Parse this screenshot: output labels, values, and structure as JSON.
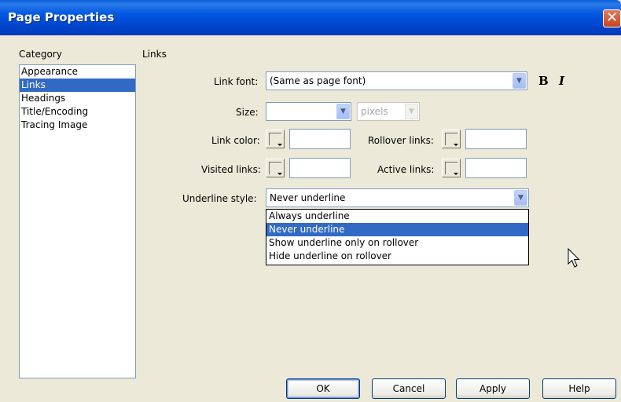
{
  "window": {
    "title": "Page Properties",
    "close_glyph": "✕"
  },
  "category": {
    "header": "Category",
    "items": [
      "Appearance",
      "Links",
      "Headings",
      "Title/Encoding",
      "Tracing Image"
    ],
    "selected_index": 1
  },
  "panel": {
    "heading": "Links",
    "link_font": {
      "label": "Link font:",
      "value": "(Same as page font)"
    },
    "bold_label": "B",
    "italic_label": "I",
    "size": {
      "label": "Size:",
      "value": "",
      "unit": "pixels"
    },
    "link_color": {
      "label": "Link color:",
      "value": ""
    },
    "rollover_links": {
      "label": "Rollover links:",
      "value": ""
    },
    "visited_links": {
      "label": "Visited links:",
      "value": ""
    },
    "active_links": {
      "label": "Active links:",
      "value": ""
    },
    "underline_style": {
      "label": "Underline style:",
      "value": "Never underline",
      "options": [
        "Always underline",
        "Never underline",
        "Show underline only on rollover",
        "Hide underline on rollover"
      ],
      "selected_index": 1
    }
  },
  "buttons": {
    "ok": "OK",
    "cancel": "Cancel",
    "apply": "Apply",
    "help": "Help"
  },
  "icons": {
    "dropdown_arrow": "chevron-down-icon",
    "color_picker": "color-swatch-icon",
    "cursor": "mouse-pointer-icon"
  },
  "colors": {
    "titlebar": "#0054e3",
    "selection": "#316ac5",
    "dialog_bg": "#ece9d8"
  }
}
